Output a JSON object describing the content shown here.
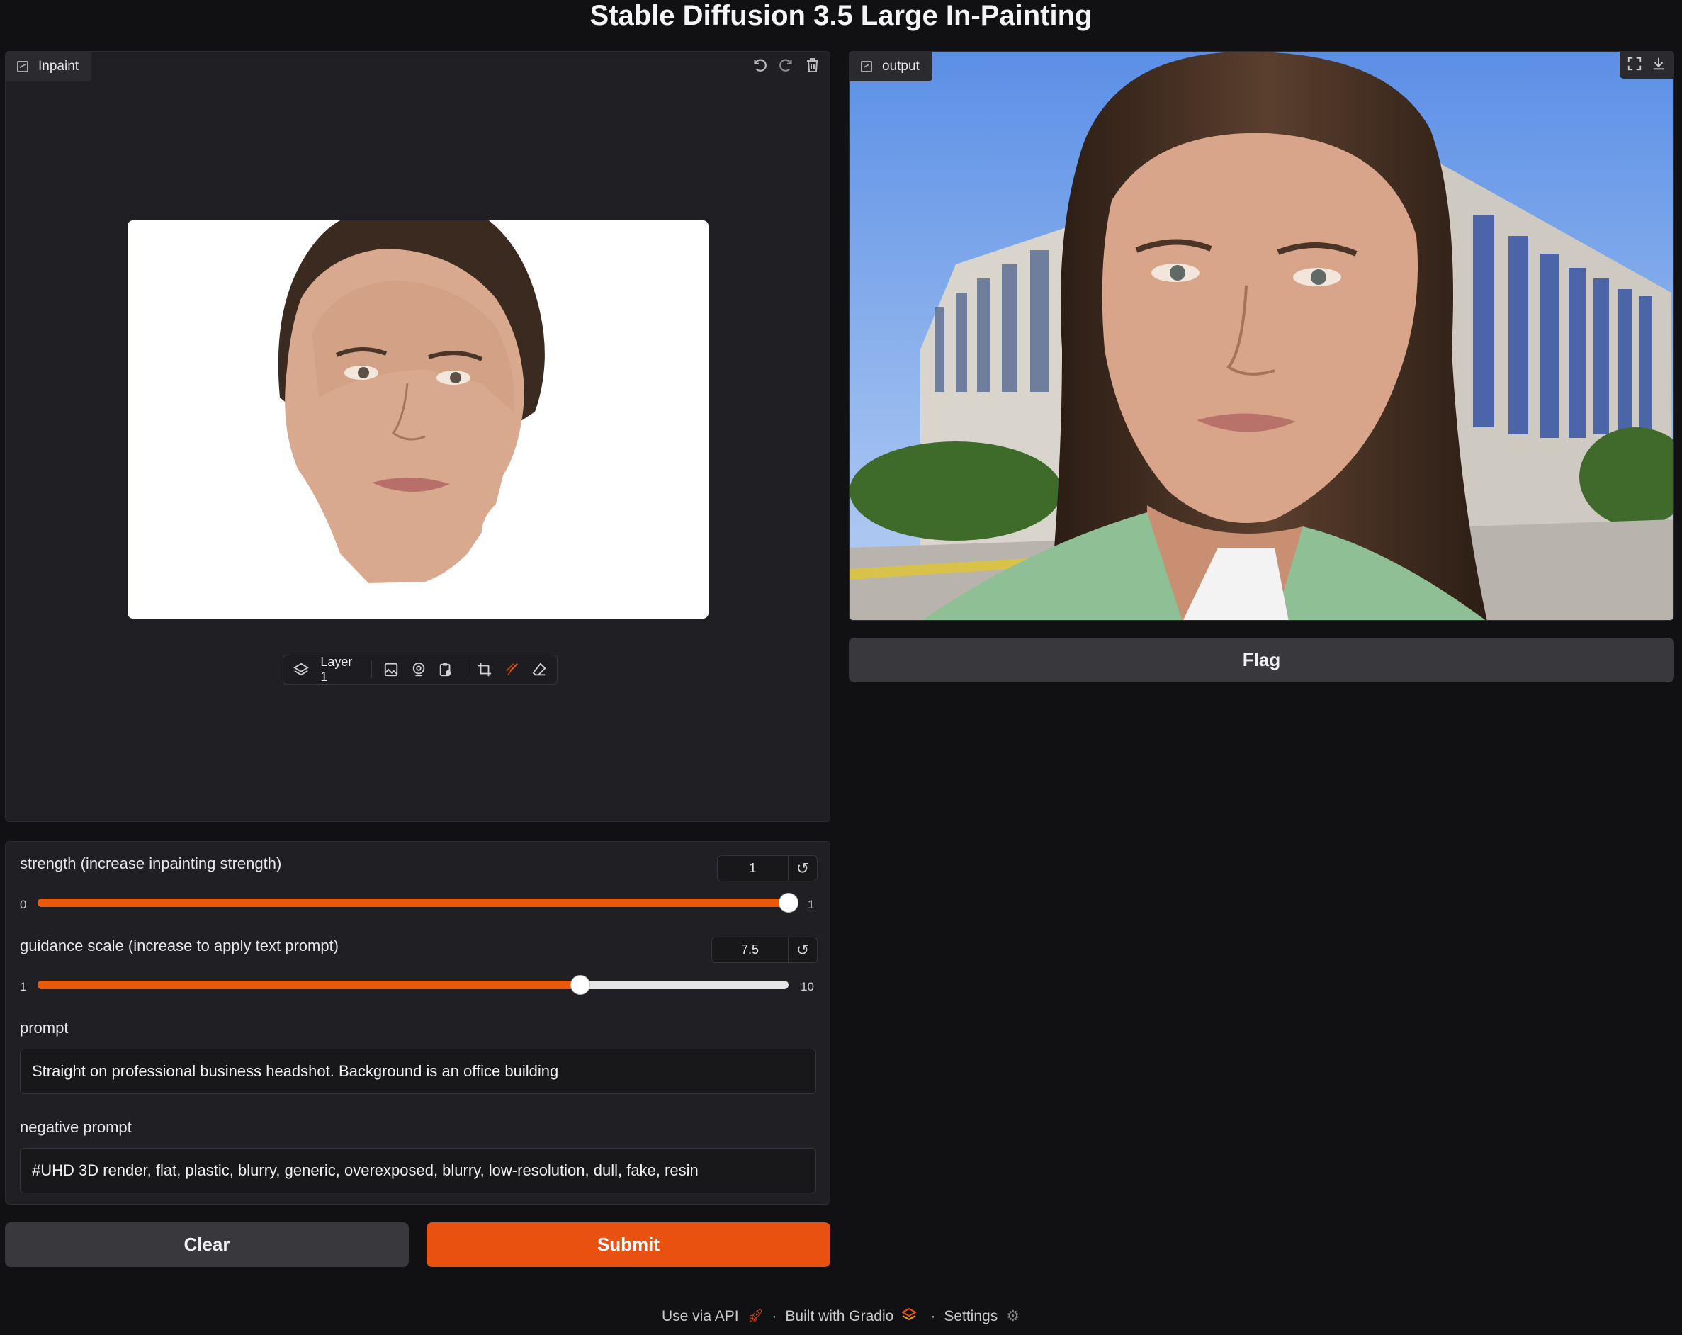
{
  "app": {
    "title": "Stable Diffusion 3.5 Large In-Painting"
  },
  "inpaint": {
    "label": "Inpaint",
    "tools": {
      "undo_icon": "undo-icon",
      "redo_icon": "redo-icon",
      "clear_icon": "trash-icon"
    },
    "layer_label": "Layer 1",
    "toolbar_icons": [
      "layers-icon",
      "image-upload-icon",
      "webcam-icon",
      "clipboard-icon",
      "crop-icon",
      "brush-icon",
      "eraser-icon"
    ]
  },
  "output": {
    "label": "output",
    "tools": {
      "fullscreen_icon": "fullscreen-icon",
      "download_icon": "download-icon"
    },
    "flag_label": "Flag"
  },
  "controls": {
    "strength": {
      "label": "strength (increase inpainting strength)",
      "value": "1",
      "min": "0",
      "max": "1",
      "fraction": 1.0
    },
    "guidance": {
      "label": "guidance scale (increase to apply text prompt)",
      "value": "7.5",
      "min": "1",
      "max": "10",
      "fraction": 0.7222
    },
    "prompt": {
      "label": "prompt",
      "value": "Straight on professional business headshot. Background is an office building"
    },
    "negative_prompt": {
      "label": "negative prompt",
      "value": "#UHD 3D render, flat, plastic, blurry, generic, overexposed, blurry, low-resolution, dull, fake, resin"
    }
  },
  "actions": {
    "clear_label": "Clear",
    "submit_label": "Submit"
  },
  "footer": {
    "api_label": "Use via API",
    "built_label": "Built with Gradio",
    "settings_label": "Settings",
    "sep": "·"
  },
  "colors": {
    "accent": "#e8510f",
    "background": "#111113",
    "panel": "#202024"
  }
}
